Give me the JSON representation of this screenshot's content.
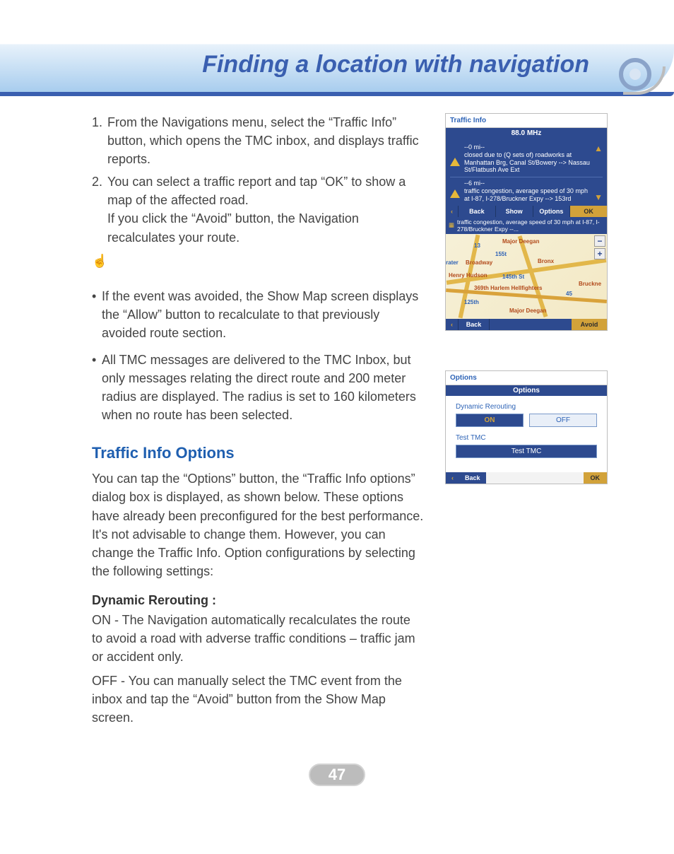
{
  "header": {
    "title": "Finding a location with navigation"
  },
  "instructions": {
    "step1_num": "1.",
    "step1": "From the Navigations menu, select the “Traffic Info” button, which opens the TMC inbox, and displays traffic reports.",
    "step2_num": "2.",
    "step2a": "You can select a traffic report and tap “OK” to show a map of the affected road.",
    "step2b": "If you click the “Avoid” button, the Navigation recalculates your route.",
    "note_icon": "☝",
    "bullet1": "If the event was avoided, the Show Map screen displays the “Allow” button to recalculate to that previously avoided route section.",
    "bullet2": "All TMC messages are delivered to the TMC Inbox, but only messages relating the direct route and 200 meter radius are displayed. The radius is set to 160 kilometers when no route has been selected."
  },
  "section": {
    "heading": "Traffic Info Options",
    "para": "You can tap the “Options” button, the “Traffic Info options” dialog box is displayed, as shown below. These options have already been preconfigured for the best performance. It's not advisable to change them. However, you can change the Traffic Info. Option configurations by selecting the following settings:",
    "sub_heading": "Dynamic Rerouting :",
    "on_text": "ON - The Navigation automatically recalculates the route to avoid a road with adverse traffic conditions – traffic jam or accident only.",
    "off_text": "OFF - You can manually select the TMC event from the inbox and tap the “Avoid” button from the Show Map screen."
  },
  "device1": {
    "titlebar": "Traffic Info",
    "freq": "88.0 MHz",
    "msg1": "--0 mi--\nclosed due to (Q sets of) roadworks at Manhattan Brg, Canal St/Bowery --> Nassau St/Flatbush Ave Ext",
    "msg2": "--6 mi--\ntraffic congestion, average speed of 30 mph at I-87, I-278/Bruckner Expy --> 153rd",
    "btn_back": "Back",
    "btn_show": "Show",
    "btn_options": "Options",
    "btn_ok": "OK",
    "map_banner": "traffic congestion, average speed of 30 mph at I-87, I-278/Bruckner Expy --...",
    "labels": {
      "major_deegan": "Major Deegan",
      "num13": "13",
      "num155t": "155t",
      "rater": "rater",
      "broadway": "Broadway",
      "bronx": "Bronx",
      "henry_hudson": "Henry Hudson",
      "st145": "145th St",
      "harlem": "369th Harlem Hellfighters",
      "bruckne": "Bruckne",
      "num45": "45",
      "st125": "125th",
      "major_deegan2": "Major Deegan"
    },
    "btn_avoid": "Avoid",
    "zoom_in": "+",
    "zoom_out": "−"
  },
  "device2": {
    "titlebar": "Options",
    "header": "Options",
    "label1": "Dynamic Rerouting",
    "btn_on": "ON",
    "btn_off": "OFF",
    "label2": "Test TMC",
    "btn_test": "Test TMC",
    "btn_back": "Back",
    "btn_ok": "OK"
  },
  "page_number": "47"
}
